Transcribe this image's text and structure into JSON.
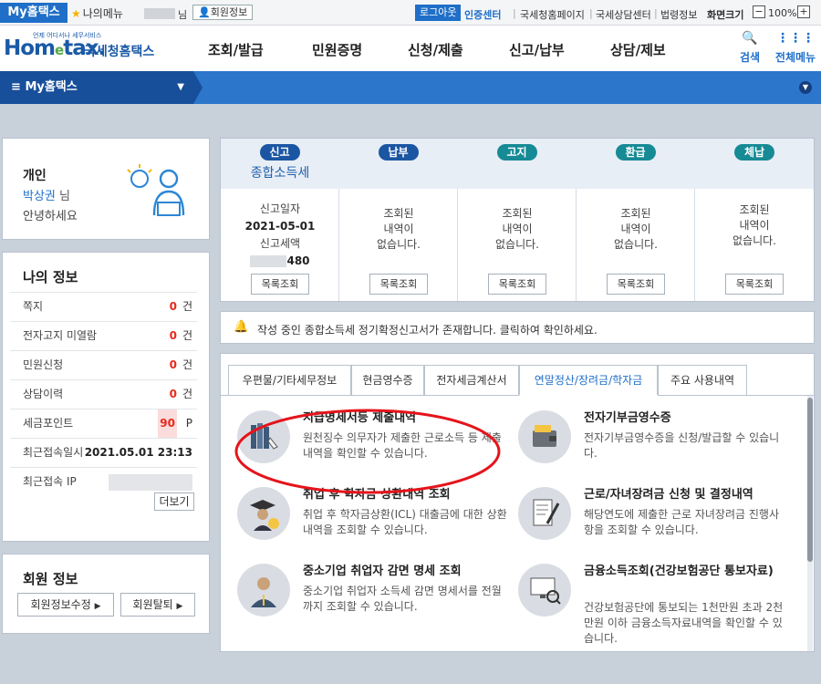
{
  "util": {
    "my_hometax": "My홈택스",
    "my_menu": "나의메뉴",
    "nim": "님",
    "member_info": "회원정보",
    "logout": "로그아웃",
    "cert_center": "인증센터",
    "links": [
      "국세청홈페이지",
      "국세상담센터",
      "법령정보"
    ],
    "zoom_label": "화면크기",
    "zoom_value": "100%"
  },
  "logo": {
    "tagline": "언제 어디서나 세무서비스",
    "name_main": "Hom",
    "name_e": "e",
    "name_tail": "tax.",
    "name_kr": "국세청홈택스"
  },
  "nav": {
    "menus": [
      "조회/발급",
      "민원증명",
      "신청/제출",
      "신고/납부",
      "상담/제보"
    ],
    "search": "검색",
    "all_menu": "전체메뉴"
  },
  "section": {
    "title": "My홈택스"
  },
  "user": {
    "type": "개인",
    "name": "박상권",
    "nim": "님",
    "greeting": "안녕하세요"
  },
  "myinfo": {
    "title": "나의 정보",
    "rows": [
      {
        "label": "쪽지",
        "value": "0",
        "unit": "건"
      },
      {
        "label": "전자고지 미열람",
        "value": "0",
        "unit": "건"
      },
      {
        "label": "민원신청",
        "value": "0",
        "unit": "건"
      },
      {
        "label": "상담이력",
        "value": "0",
        "unit": "건"
      },
      {
        "label": "세금포인트",
        "value": "90",
        "unit": "P"
      }
    ],
    "last_login_label": "최근접속일시",
    "last_login": "2021.05.01 23:13",
    "last_ip_label": "최근접속 IP",
    "more": "더보기"
  },
  "member": {
    "title": "회원 정보",
    "edit": "회원정보수정",
    "withdraw": "회원탈퇴"
  },
  "summary": [
    {
      "pill": "신고",
      "title": "종합소득세",
      "lines": [
        "신고일자",
        "2021-05-01",
        "신고세액",
        "480"
      ],
      "button": "목록조회"
    },
    {
      "pill": "납부",
      "lines": [
        "조회된",
        "내역이",
        "없습니다."
      ],
      "button": "목록조회"
    },
    {
      "pill": "고지",
      "lines": [
        "조회된",
        "내역이",
        "없습니다."
      ],
      "button": "목록조회"
    },
    {
      "pill": "환급",
      "lines": [
        "조회된",
        "내역이",
        "없습니다."
      ],
      "button": "목록조회"
    },
    {
      "pill": "체납",
      "lines": [
        "조회된",
        "내역이",
        "없습니다."
      ],
      "button": "목록조회"
    }
  ],
  "notice": {
    "text": "작성 중인 종합소득세 정기확정신고서가 존재합니다. 클릭하여 확인하세요."
  },
  "tabs": [
    "우편물/기타세무정보",
    "현금영수증",
    "전자세금계산서",
    "연말정산/장려금/학자금",
    "주요 사용내역"
  ],
  "items": [
    {
      "title": "지급명세서등 제출내역",
      "desc": "원천징수 의무자가 제출한 근로소득 등 제출내역을 확인할 수 있습니다."
    },
    {
      "title": "전자기부금영수증",
      "desc": "전자기부금영수증을 신청/발급할 수 있습니다."
    },
    {
      "title": "취업 후 학자금 상환내역 조회",
      "desc": "취업 후 학자금상환(ICL) 대출금에 대한 상환내역을 조회할 수 있습니다."
    },
    {
      "title": "근로/자녀장려금 신청 및 결정내역",
      "desc": "해당연도에 제출한 근로 자녀장려금 진행사항을 조회할 수 있습니다."
    },
    {
      "title": "중소기업 취업자 감면 명세 조회",
      "desc": "중소기업 취업자 소득세 감면 명세서를 전월까지 조회할 수 있습니다."
    },
    {
      "title": "금융소득조회(건강보험공단 통보자료)",
      "desc": "건강보험공단에 통보되는 1천만원 초과 2천만원 이하 금융소득자료내역을 확인할 수 있습니다."
    }
  ]
}
